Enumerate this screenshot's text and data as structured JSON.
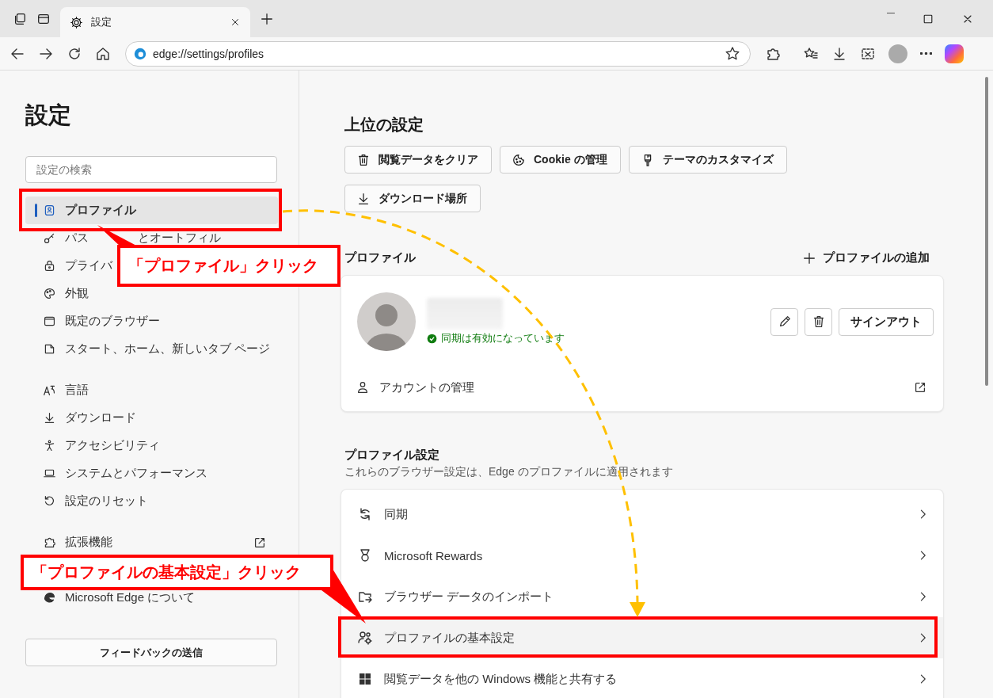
{
  "browser": {
    "tabs": [
      {
        "label": "設定",
        "selected": true
      }
    ],
    "address": "edge://settings/profiles"
  },
  "sidebar": {
    "title": "設定",
    "search": {
      "placeholder": "設定の検索"
    },
    "groups": [
      [
        {
          "label": "プロファイル",
          "selected": true
        },
        {
          "label": "パス",
          "label_2": "とオートフィル",
          "selected": false
        },
        {
          "label": "プライバ",
          "selected": false
        },
        {
          "label": "外観",
          "selected": false
        },
        {
          "label": "既定のブラウザー",
          "selected": false
        },
        {
          "label": "スタート、ホーム、新しいタブ ページ",
          "selected": false
        }
      ],
      [
        {
          "label": "言語",
          "selected": false
        },
        {
          "label": "ダウンロード",
          "selected": false
        },
        {
          "label": "アクセシビリティ",
          "selected": false
        },
        {
          "label": "システムとパフォーマンス",
          "selected": false
        },
        {
          "label": "設定のリセット",
          "selected": false
        }
      ],
      [
        {
          "label": "拡張機能",
          "selected": false
        },
        {
          "label": "Microsoft Edge について",
          "selected": false
        }
      ]
    ],
    "feedback": "フィードバックの送信"
  },
  "main": {
    "quick": {
      "title": "上位の設定",
      "buttons": [
        "閲覧データをクリア",
        "Cookie の管理",
        "テーマのカスタマイズ",
        "ダウンロード場所"
      ]
    },
    "profile": {
      "title": "プロファイル",
      "add": "プロファイルの追加",
      "sync_status": "同期は有効になっています",
      "sign_out": "サインアウト",
      "manage": "アカウントの管理"
    },
    "profile_settings": {
      "title": "プロファイル設定",
      "subtitle": "これらのブラウザー設定は、Edge のプロファイルに適用されます",
      "rows": [
        {
          "label": "同期",
          "hovered": false
        },
        {
          "label": "Microsoft Rewards",
          "hovered": false
        },
        {
          "label": "ブラウザー データのインポート",
          "hovered": false
        },
        {
          "label": "プロファイルの基本設定",
          "hovered": true
        },
        {
          "label": "閲覧データを他の Windows 機能と共有する",
          "hovered": false
        }
      ]
    }
  },
  "annotations": {
    "callouts": [
      "「プロファイル」クリック",
      "「プロファイルの基本設定」クリック"
    ]
  }
}
